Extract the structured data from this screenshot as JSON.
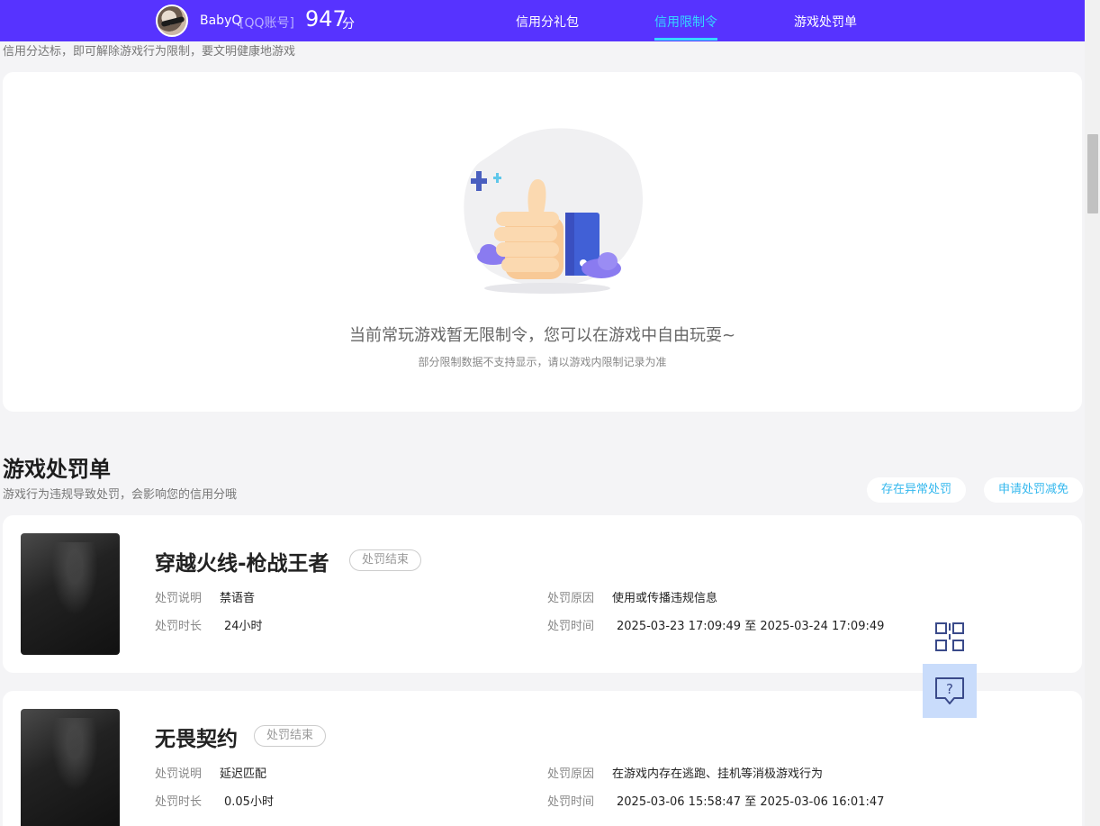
{
  "header": {
    "username": "BabyQ",
    "account_type": "[QQ账号]",
    "score": "947",
    "score_unit": "分",
    "tabs": [
      {
        "label": "信用分礼包",
        "active": false
      },
      {
        "label": "信用限制令",
        "active": true
      },
      {
        "label": "游戏处罚单",
        "active": false
      }
    ]
  },
  "limit_section": {
    "description": "信用分达标，即可解除游戏行为限制，要文明健康地游戏",
    "empty_text": "当前常玩游戏暂无限制令，您可以在游戏中自由玩耍~",
    "empty_subtext": "部分限制数据不支持显示，请以游戏内限制记录为准"
  },
  "punish_section": {
    "title": "游戏处罚单",
    "subtitle": "游戏行为违规导致处罚，会影响您的信用分哦",
    "buttons": {
      "abnormal": "存在异常处罚",
      "reduce": "申请处罚减免"
    },
    "field_labels": {
      "explain": "处罚说明",
      "duration": "处罚时长",
      "reason": "处罚原因",
      "time": "处罚时间"
    },
    "items": [
      {
        "game": "穿越火线-枪战王者",
        "status": "处罚结束",
        "explain": "禁语音",
        "duration": "24小时",
        "reason": "使用或传播违规信息",
        "time": "2025-03-23 17:09:49 至 2025-03-24 17:09:49"
      },
      {
        "game": "无畏契约",
        "status": "处罚结束",
        "explain": "延迟匹配",
        "duration": "0.05小时",
        "reason": "在游戏内存在逃跑、挂机等消极游戏行为",
        "time": "2025-03-06 15:58:47 至 2025-03-06 16:01:47"
      }
    ]
  },
  "float_panel": {
    "qr_icon": "qr-code-icon",
    "help_icon": "help-chat-icon"
  },
  "colors": {
    "brand": "#5733ff",
    "accent": "#35d8ff",
    "link": "#35b8ee"
  }
}
